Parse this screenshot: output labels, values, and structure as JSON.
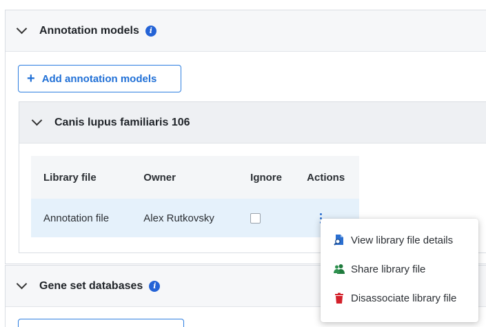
{
  "annotation_section": {
    "title": "Annotation models",
    "add_button_label": "Add annotation models"
  },
  "library_group": {
    "title": "Canis lupus familiaris 106",
    "table": {
      "headers": [
        "Library file",
        "Owner",
        "Ignore",
        "Actions"
      ],
      "rows": [
        {
          "library_file": "Annotation file",
          "owner": "Alex Rutkovsky",
          "ignore": false
        }
      ]
    }
  },
  "gene_section": {
    "title": "Gene set databases"
  },
  "actions_menu": {
    "items": [
      {
        "label": "View library file details",
        "icon": "file-search-icon",
        "color": "#2b6fd0"
      },
      {
        "label": "Share library file",
        "icon": "users-icon",
        "color": "#1e7a3c"
      },
      {
        "label": "Disassociate library file",
        "icon": "trash-icon",
        "color": "#d3202a"
      }
    ]
  },
  "colors": {
    "accent": "#1f6fd6",
    "info": "#2463d6",
    "selected_row": "#e5f1fb",
    "danger": "#d3202a",
    "success": "#1e7a3c"
  }
}
